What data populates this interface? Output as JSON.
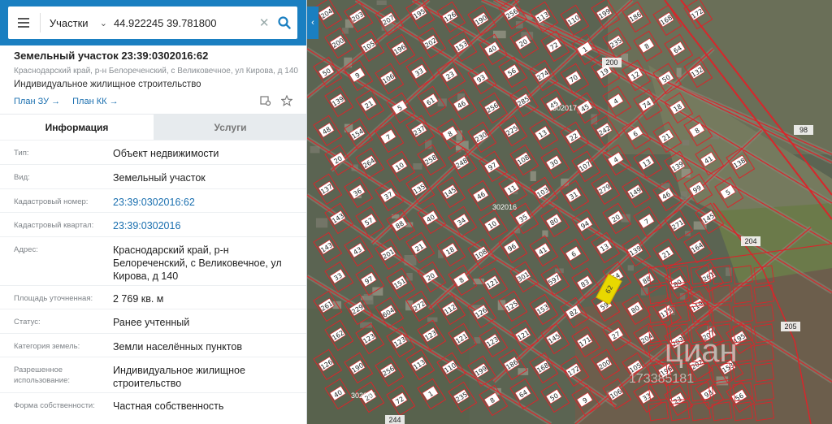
{
  "search": {
    "layer": "Участки",
    "query": "44.922245 39.781800"
  },
  "object": {
    "title": "Земельный участок 23:39:0302016:62",
    "address": "Краснодарский край, р-н Белореченский, с Великовечное, ул Кирова, д 140",
    "use": "Индивидуальное жилищное строительство",
    "plan_zu": "План ЗУ →",
    "plan_kk": "План КК →"
  },
  "tabs": {
    "info": "Информация",
    "services": "Услуги"
  },
  "rows": [
    {
      "label": "Тип:",
      "value": "Объект недвижимости"
    },
    {
      "label": "Вид:",
      "value": "Земельный участок"
    },
    {
      "label": "Кадастровый номер:",
      "value": "23:39:0302016:62"
    },
    {
      "label": "Кадастровый квартал:",
      "value": "23:39:0302016"
    },
    {
      "label": "Адрес:",
      "value": "Краснодарский край, р-н Белореченский, с Великовечное, ул Кирова, д 140"
    },
    {
      "label": "Площадь уточненная:",
      "value": "2 769 кв. м"
    },
    {
      "label": "Статус:",
      "value": "Ранее учтенный"
    },
    {
      "label": "Категория земель:",
      "value": "Земли населённых пунктов"
    },
    {
      "label": "Разрешенное использование:",
      "value": "Индивидуальное жилищное строительство"
    },
    {
      "label": "Форма собственности:",
      "value": "Частная собственность"
    }
  ],
  "map": {
    "quarter_labels": [
      "302017",
      "302016",
      "302015"
    ],
    "big_numbers": [
      "200",
      "98",
      "204",
      "205",
      "244"
    ],
    "selected_plot": "62",
    "watermark": "циан",
    "watermark_id": "173385181",
    "plot_numbers": [
      "204",
      "203",
      "207",
      "195",
      "126",
      "190",
      "256",
      "113",
      "110",
      "199",
      "186",
      "168",
      "172",
      "200",
      "105",
      "196",
      "202",
      "153",
      "40",
      "20",
      "72",
      "1",
      "235",
      "8",
      "64",
      "50",
      "9",
      "106",
      "33",
      "23",
      "93",
      "56",
      "274",
      "70",
      "19",
      "12",
      "50",
      "132",
      "139",
      "21",
      "5",
      "61",
      "46",
      "256",
      "285",
      "45",
      "45",
      "4",
      "74",
      "18",
      "48",
      "154",
      "7",
      "237",
      "8",
      "230",
      "225",
      "13",
      "22",
      "242",
      "6",
      "21",
      "8",
      "20",
      "264",
      "10",
      "258",
      "248",
      "97",
      "108",
      "30",
      "107",
      "4",
      "13",
      "139",
      "41",
      "138",
      "137",
      "36",
      "37",
      "135",
      "145",
      "46",
      "11",
      "103",
      "31",
      "279",
      "149",
      "46",
      "99",
      "5",
      "143",
      "57",
      "88",
      "40",
      "34",
      "10",
      "35",
      "80",
      "94",
      "20",
      "7",
      "271",
      "145",
      "143",
      "43",
      "201",
      "21",
      "18",
      "108",
      "96",
      "41",
      "6",
      "13",
      "139",
      "21",
      "164",
      "33",
      "97",
      "151",
      "20",
      "8",
      "121",
      "301",
      "597",
      "83",
      "64",
      "88",
      "80",
      "261",
      "261",
      "229",
      "604",
      "272",
      "112",
      "126",
      "125",
      "153",
      "82",
      "59",
      "80",
      "115",
      "119",
      "162",
      "123",
      "123",
      "123",
      "121",
      "123",
      "121",
      "145",
      "171",
      "27"
    ],
    "colors": {
      "boundary": "#d8262b",
      "selected": "#e8d800",
      "satellite": "#5d6552"
    }
  }
}
